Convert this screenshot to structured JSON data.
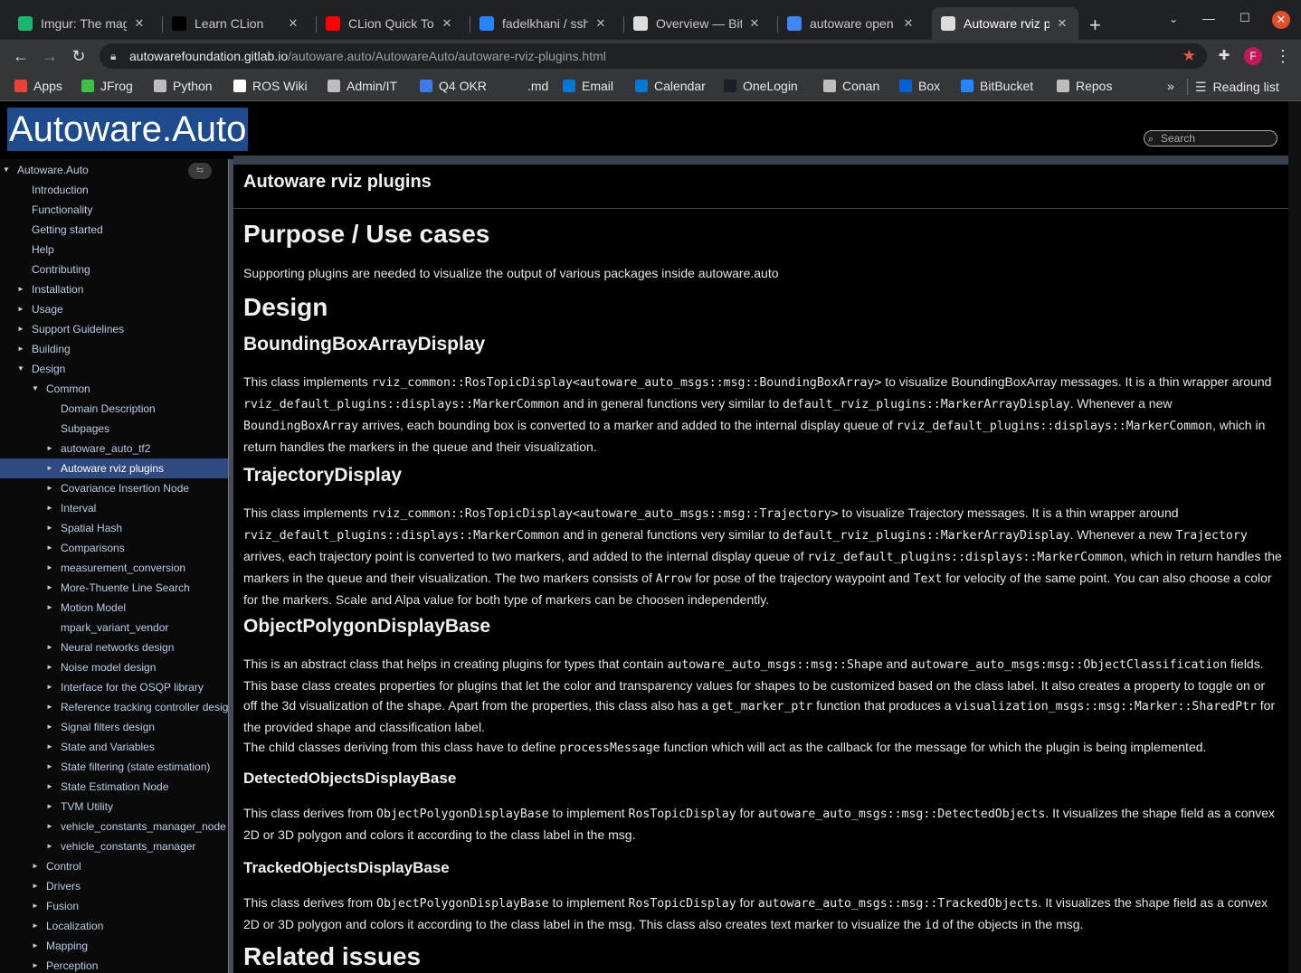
{
  "browser": {
    "tabs": [
      {
        "title": "Imgur: The mag",
        "favicon_color": "#1bb76e"
      },
      {
        "title": "Learn CLion",
        "favicon_color": "#000000"
      },
      {
        "title": "CLion Quick To",
        "favicon_color": "#ff0000"
      },
      {
        "title": "fadelkhani / ssh",
        "favicon_color": "#2684ff"
      },
      {
        "title": "Overview — Bit",
        "favicon_color": "#dddddd"
      },
      {
        "title": "autoware open",
        "favicon_color": "#4285f4"
      },
      {
        "title": "Autoware rviz p",
        "favicon_color": "#dddddd"
      }
    ],
    "new_tab_label": "+",
    "address": {
      "host": "autowarefoundation.gitlab.io",
      "path": "/autoware.auto/AutowareAuto/autoware-rviz-plugins.html"
    },
    "profile_initial": "F",
    "bookmarks": [
      {
        "label": "Apps",
        "icon_color": "#ea4335"
      },
      {
        "label": "JFrog",
        "icon_color": "#41bf47"
      },
      {
        "label": "Python",
        "icon_color": "#bdbdbd"
      },
      {
        "label": "ROS Wiki",
        "icon_color": "#ffffff"
      },
      {
        "label": "Admin/IT",
        "icon_color": "#bdbdbd"
      },
      {
        "label": "Q4 OKR",
        "icon_color": "#3f7be8"
      },
      {
        "label": ".md",
        "icon_color": "#35363a"
      },
      {
        "label": "Email",
        "icon_color": "#0078d4"
      },
      {
        "label": "Calendar",
        "icon_color": "#0078d4"
      },
      {
        "label": "OneLogin",
        "icon_color": "#1c1f2a"
      },
      {
        "label": "Conan",
        "icon_color": "#bdbdbd"
      },
      {
        "label": "Box",
        "icon_color": "#0061d5"
      },
      {
        "label": "BitBucket",
        "icon_color": "#2684ff"
      },
      {
        "label": "Repos",
        "icon_color": "#bdbdbd"
      }
    ],
    "overflow_label": "»",
    "reading_list_label": "Reading list"
  },
  "site": {
    "brand": "Autoware.Auto",
    "search_placeholder": "Search"
  },
  "nav": [
    {
      "label": "Autoware.Auto",
      "arrow": "▼",
      "level": 0
    },
    {
      "label": "Introduction",
      "arrow": "",
      "level": 1
    },
    {
      "label": "Functionality",
      "arrow": "",
      "level": 1
    },
    {
      "label": "Getting started",
      "arrow": "",
      "level": 1
    },
    {
      "label": "Help",
      "arrow": "",
      "level": 1
    },
    {
      "label": "Contributing",
      "arrow": "",
      "level": 1
    },
    {
      "label": "Installation",
      "arrow": "►",
      "level": 1
    },
    {
      "label": "Usage",
      "arrow": "►",
      "level": 1
    },
    {
      "label": "Support Guidelines",
      "arrow": "►",
      "level": 1
    },
    {
      "label": "Building",
      "arrow": "►",
      "level": 1
    },
    {
      "label": "Design",
      "arrow": "▼",
      "level": 1
    },
    {
      "label": "Common",
      "arrow": "▼",
      "level": 2
    },
    {
      "label": "Domain Description",
      "arrow": "",
      "level": 3
    },
    {
      "label": "Subpages",
      "arrow": "",
      "level": 3
    },
    {
      "label": "autoware_auto_tf2",
      "arrow": "►",
      "level": 3
    },
    {
      "label": "Autoware rviz plugins",
      "arrow": "►",
      "level": 3,
      "selected": true
    },
    {
      "label": "Covariance Insertion Node",
      "arrow": "►",
      "level": 3
    },
    {
      "label": "Interval",
      "arrow": "►",
      "level": 3
    },
    {
      "label": "Spatial Hash",
      "arrow": "►",
      "level": 3
    },
    {
      "label": "Comparisons",
      "arrow": "►",
      "level": 3
    },
    {
      "label": "measurement_conversion",
      "arrow": "►",
      "level": 3
    },
    {
      "label": "More-Thuente Line Search",
      "arrow": "►",
      "level": 3
    },
    {
      "label": "Motion Model",
      "arrow": "►",
      "level": 3
    },
    {
      "label": "mpark_variant_vendor",
      "arrow": "",
      "level": 3
    },
    {
      "label": "Neural networks design",
      "arrow": "►",
      "level": 3
    },
    {
      "label": "Noise model design",
      "arrow": "►",
      "level": 3
    },
    {
      "label": "Interface for the OSQP library",
      "arrow": "►",
      "level": 3
    },
    {
      "label": "Reference tracking controller desig",
      "arrow": "►",
      "level": 3
    },
    {
      "label": "Signal filters design",
      "arrow": "►",
      "level": 3
    },
    {
      "label": "State and Variables",
      "arrow": "►",
      "level": 3
    },
    {
      "label": "State filtering (state estimation)",
      "arrow": "►",
      "level": 3
    },
    {
      "label": "State Estimation Node",
      "arrow": "►",
      "level": 3
    },
    {
      "label": "TVM Utility",
      "arrow": "►",
      "level": 3
    },
    {
      "label": "vehicle_constants_manager_node",
      "arrow": "►",
      "level": 3
    },
    {
      "label": "vehicle_constants_manager",
      "arrow": "►",
      "level": 3
    },
    {
      "label": "Control",
      "arrow": "►",
      "level": 2
    },
    {
      "label": "Drivers",
      "arrow": "►",
      "level": 2
    },
    {
      "label": "Fusion",
      "arrow": "►",
      "level": 2
    },
    {
      "label": "Localization",
      "arrow": "►",
      "level": 2
    },
    {
      "label": "Mapping",
      "arrow": "►",
      "level": 2
    },
    {
      "label": "Perception",
      "arrow": "►",
      "level": 2
    }
  ],
  "article": {
    "page_title": "Autoware rviz plugins",
    "h_purpose": "Purpose / Use cases",
    "purpose_text": "Supporting plugins are needed to visualize the output of various packages inside autoware.auto",
    "h_design": "Design",
    "h_bbox": "BoundingBoxArrayDisplay",
    "bbox": {
      "t1": "This class implements ",
      "c1": "rviz_common::RosTopicDisplay<autoware_auto_msgs::msg::BoundingBoxArray>",
      "t2": " to visualize BoundingBoxArray messages. It is a thin wrapper around ",
      "c2": "rviz_default_plugins::displays::MarkerCommon",
      "t3": " and in general functions very similar to ",
      "c3": "default_rviz_plugins::MarkerArrayDisplay",
      "t4": ". Whenever a new ",
      "c4": "BoundingBoxArray",
      "t5": " arrives, each bounding box is converted to a marker and added to the internal display queue of ",
      "c5": "rviz_default_plugins::displays::MarkerCommon",
      "t6": ", which in return handles the markers in the queue and their visualization."
    },
    "h_traj": "TrajectoryDisplay",
    "traj": {
      "t1": "This class implements ",
      "c1": "rviz_common::RosTopicDisplay<autoware_auto_msgs::msg::Trajectory>",
      "t2": " to visualize Trajectory messages. It is a thin wrapper around ",
      "c2": "rviz_default_plugins::displays::MarkerCommon",
      "t3": " and in general functions very similar to ",
      "c3": "default_rviz_plugins::MarkerArrayDisplay",
      "t4": ". Whenever a new ",
      "c4": "Trajectory",
      "t5": " arrives, each trajectory point is converted to two markers, and added to the internal display queue of ",
      "c5": "rviz_default_plugins::displays::MarkerCommon",
      "t6": ", which in return handles the markers in the queue and their visualization. The two markers consists of ",
      "c6": "Arrow",
      "t7": " for pose of the trajectory waypoint and ",
      "c7": "Text",
      "t8": " for velocity of the same point. You can also choose a color for the markers. Scale and Alpa value for both type of markers can be choosen independently."
    },
    "h_poly": "ObjectPolygonDisplayBase",
    "poly": {
      "t1": "This is an abstract class that helps in creating plugins for types that contain ",
      "c1": "autoware_auto_msgs::msg::Shape",
      "t2": " and ",
      "c2": "autoware_auto_msgs:msg::ObjectClassification",
      "t3": " fields. This base class creates properties for plugins that let the color and transparency values for shapes to be customized based on the class label. It also creates a property to toggle on or off the 3d visualization of the shape. Apart from the properties, this class also has a ",
      "c3": "get_marker_ptr",
      "t4": " function that produces a ",
      "c4": "visualization_msgs::msg::Marker::SharedPtr",
      "t5": " for the provided shape and classification label.",
      "t6": "The child classes deriving from this class have to define ",
      "c6": "processMessage",
      "t7": " function which will act as the callback for the message for which the plugin is being implemented."
    },
    "h_detected": "DetectedObjectsDisplayBase",
    "detected": {
      "t1": "This class derives from ",
      "c1": "ObjectPolygonDisplayBase",
      "t2": " to implement ",
      "c2": "RosTopicDisplay",
      "t3": " for ",
      "c3": "autoware_auto_msgs::msg::DetectedObjects",
      "t4": ". It visualizes the shape field as a convex 2D or 3D polygon and colors it according to the class label in the msg."
    },
    "h_tracked": "TrackedObjectsDisplayBase",
    "tracked": {
      "t1": "This class derives from ",
      "c1": "ObjectPolygonDisplayBase",
      "t2": " to implement ",
      "c2": "RosTopicDisplay",
      "t3": " for ",
      "c3": "autoware_auto_msgs::msg::TrackedObjects",
      "t4": ". It visualizes the shape field as a convex 2D or 3D polygon and colors it according to the class label in the msg. This class also creates text marker to visualize the ",
      "c4": "id",
      "t5": " of the objects in the msg."
    },
    "h_related": "Related issues"
  }
}
